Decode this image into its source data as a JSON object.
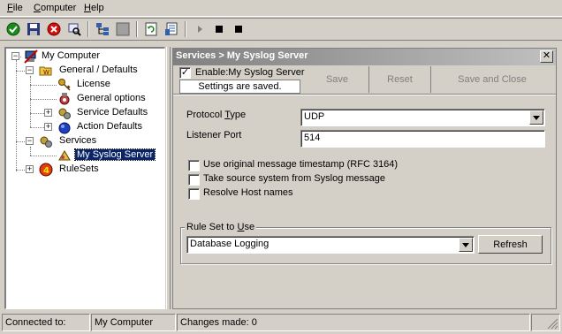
{
  "menu": {
    "file": {
      "accel": "F",
      "rest": "ile"
    },
    "computer": {
      "accel": "C",
      "rest": "omputer"
    },
    "help": {
      "accel": "H",
      "rest": "elp"
    }
  },
  "toolbar": {
    "icons": [
      "check-icon",
      "save-icon",
      "stop-icon",
      "search-icon",
      "tree-icon",
      "blank-icon",
      "refresh-icon",
      "config-icon",
      "play-icon",
      "stop-square-icon",
      "stop-square-small-icon"
    ]
  },
  "tree": {
    "my_computer": "My Computer",
    "general_defaults": "General / Defaults",
    "license": "License",
    "general_options": "General options",
    "service_defaults": "Service Defaults",
    "action_defaults": "Action Defaults",
    "services": "Services",
    "my_syslog_server": "My Syslog Server",
    "rulesets": "RuleSets"
  },
  "panel": {
    "title": "Services > My Syslog Server",
    "close": "✕",
    "enable_label": "Enable:My Syslog Server",
    "enable_checked": true,
    "saved_status": "Settings are saved.",
    "save": "Save",
    "reset": "Reset",
    "save_and_close": "Save and Close",
    "protocol_type_pre": "Protocol ",
    "protocol_type_accel": "T",
    "protocol_type_post": "ype",
    "protocol_value": "UDP",
    "listener_port_label": "Listener Port",
    "listener_port_value": "514",
    "opt_timestamp": "Use original message timestamp (RFC 3164)",
    "opt_source": "Take source system from Syslog message",
    "opt_resolve": "Resolve Host names",
    "ruleset_group_pre": "Rule Set to ",
    "ruleset_group_accel": "U",
    "ruleset_group_post": "se",
    "ruleset_value": "Database Logging",
    "refresh": "Refresh"
  },
  "status": {
    "connected": "Connected to:",
    "computer": "My Computer",
    "changes": "Changes made: 0"
  }
}
